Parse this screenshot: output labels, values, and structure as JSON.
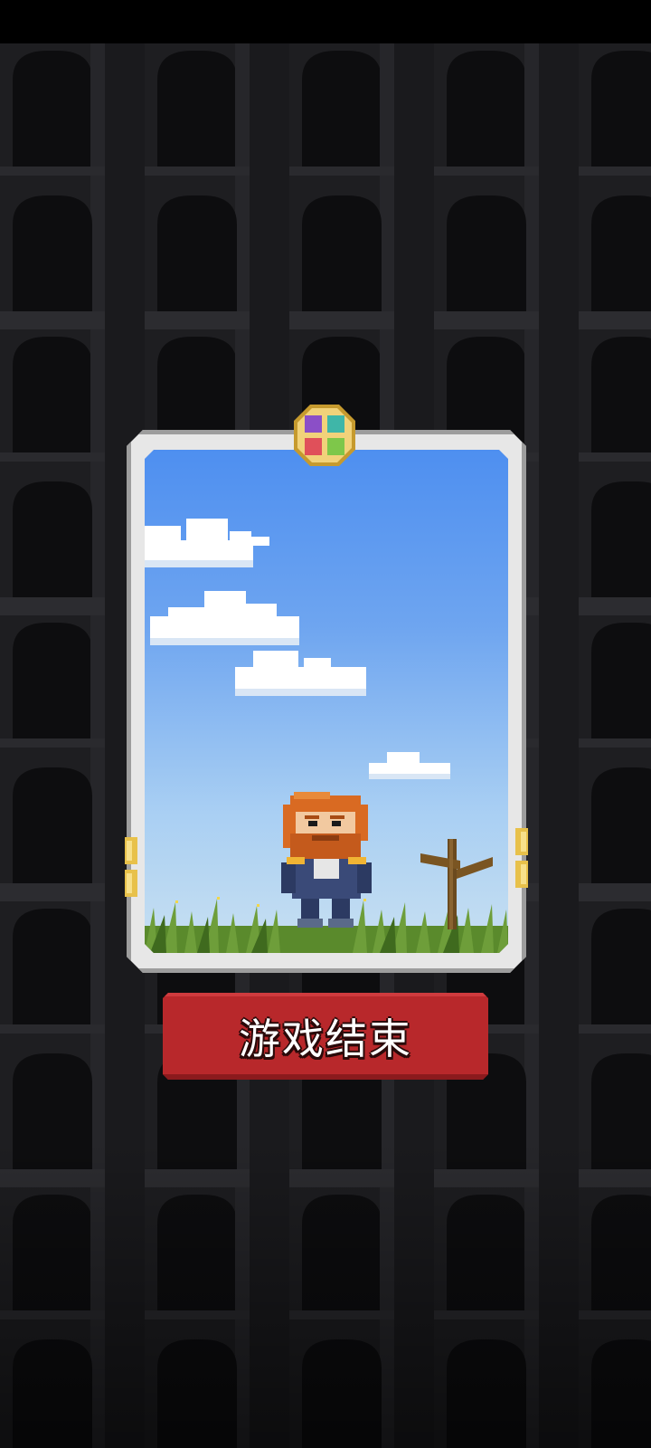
{
  "screen": {
    "name": "game-over",
    "background_color": "#141416",
    "status_strip_color": "#000000"
  },
  "card": {
    "frame_color": "#e7e7e7",
    "frame_border_color": "#9d9d9d",
    "sky_top_color": "#4e8ff0",
    "sky_bottom_color": "#c8e0f1",
    "grass_color": "#5a8a2c",
    "medal_icon": "four-quadrant-medal-icon",
    "character": "bearded-red-haired-knight",
    "prop": "wooden-signpost"
  },
  "button": {
    "label": "游戏结束",
    "color": "#b8282b",
    "shadow_color": "#8b1a1d",
    "text_color": "#ffffff"
  }
}
